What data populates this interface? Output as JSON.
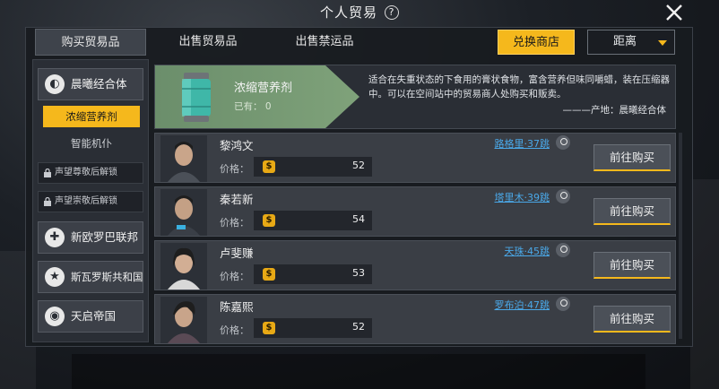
{
  "header": {
    "title": "个人贸易",
    "help_icon": "?"
  },
  "tabs": [
    {
      "label": "购买贸易品",
      "active": true
    },
    {
      "label": "出售贸易品",
      "active": false
    },
    {
      "label": "出售禁运品",
      "active": false
    }
  ],
  "toolbar": {
    "exchange_label": "兑换商店",
    "sort_label": "距离"
  },
  "sidebar": {
    "faction_1": "晨曦经合体",
    "sub_active": "浓缩营养剂",
    "sub_plain": "智能机仆",
    "locked_1": "声望尊敬后解锁",
    "locked_2": "声望崇敬后解锁",
    "faction_2": "新欧罗巴联邦",
    "faction_3": "斯瓦罗斯共和国",
    "faction_4": "天启帝国"
  },
  "item": {
    "name": "浓缩营养剂",
    "owned": "已有： 0",
    "description": "适合在失重状态的下食用的膏状食物，富含营养但味同嚼蜡，装在压缩器中。可以在空间站中的贸易商人处购买和贩卖。",
    "origin": "———产地：晨曦经合体"
  },
  "merchants": [
    {
      "name": "黎鸿文",
      "location": "路格里·37跳",
      "price_label": "价格：",
      "price": "52",
      "buy_label": "前往购买"
    },
    {
      "name": "秦若新",
      "location": "塔里木·39跳",
      "price_label": "价格：",
      "price": "54",
      "buy_label": "前往购买"
    },
    {
      "name": "卢斐赚",
      "location": "天珠·45跳",
      "price_label": "价格：",
      "price": "53",
      "buy_label": "前往购买"
    },
    {
      "name": "陈嘉熙",
      "location": "罗布泊·47跳",
      "price_label": "价格：",
      "price": "52",
      "buy_label": "前往购买"
    }
  ],
  "colors": {
    "accent": "#f5b81c",
    "link": "#4aa8e8",
    "item_green": "#7fa27a"
  }
}
